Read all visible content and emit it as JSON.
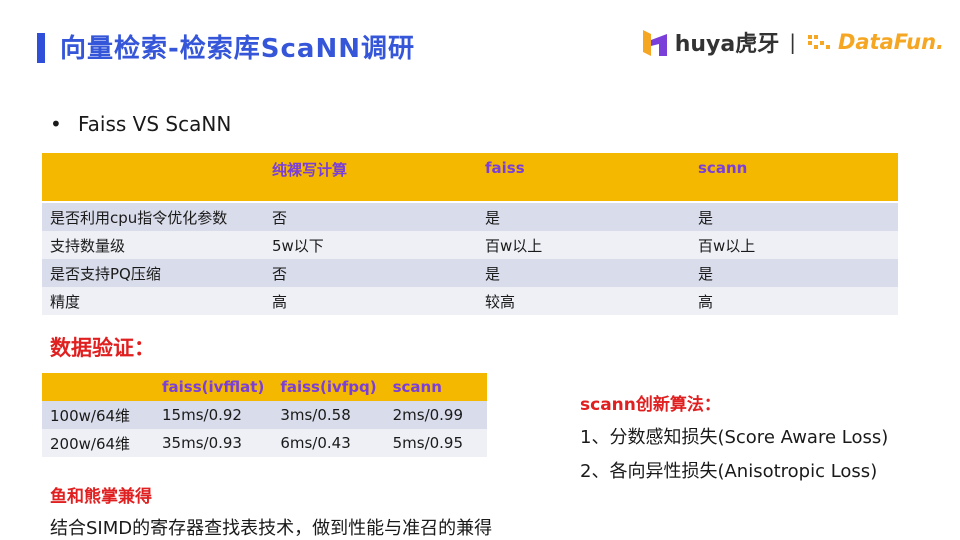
{
  "header": {
    "title": "向量检索-检索库ScaNN调研",
    "logo_huya": "huya虎牙",
    "logo_separator": "|",
    "logo_datafun": "DataFun."
  },
  "bullet": {
    "symbol": "•",
    "text": "Faiss VS ScaNN"
  },
  "comparison_table": {
    "headers": [
      "",
      "纯裸写计算",
      "faiss",
      "scann"
    ],
    "rows": [
      [
        "是否利用cpu指令优化参数",
        "否",
        "是",
        "是"
      ],
      [
        "支持数量级",
        "5w以下",
        "百w以上",
        "百w以上"
      ],
      [
        "是否支持PQ压缩",
        "否",
        "是",
        "是"
      ],
      [
        "精度",
        "高",
        "较高",
        "高"
      ]
    ]
  },
  "verify": {
    "title": "数据验证：",
    "headers": [
      "",
      "faiss(ivfflat)",
      "faiss(ivfpq)",
      "scann"
    ],
    "rows": [
      [
        "100w/64维",
        "15ms/0.92",
        "3ms/0.58",
        "2ms/0.99"
      ],
      [
        "200w/64维",
        "35ms/0.93",
        "6ms/0.43",
        "5ms/0.95"
      ]
    ]
  },
  "fish": {
    "title": "鱼和熊掌兼得",
    "body": "结合SIMD的寄存器查找表技术，做到性能与准召的兼得"
  },
  "algorithm": {
    "title": "scann创新算法：",
    "items": [
      "1、分数感知损失(Score Aware Loss)",
      "2、各向异性损失(Anisotropic Loss)"
    ]
  },
  "colors": {
    "title_blue": "#3556d8",
    "header_yellow": "#f5b800",
    "header_text_purple": "#7a3fd8",
    "section_red": "#e02020",
    "row_dark": "#d9dcea",
    "row_light": "#eef0f6"
  },
  "icons": [
    "huya-logo-icon",
    "datafun-logo-icon"
  ]
}
